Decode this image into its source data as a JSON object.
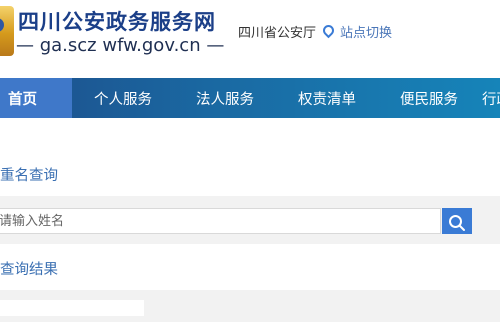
{
  "header": {
    "site_title": "四川公安政务服务网",
    "site_url": "— ga.scz wfw.gov.cn —",
    "department": "四川省公安厅",
    "switch_label": "站点切换"
  },
  "nav": {
    "items": [
      {
        "label": "首页",
        "active": true
      },
      {
        "label": "个人服务"
      },
      {
        "label": "法人服务"
      },
      {
        "label": "权责清单"
      },
      {
        "label": "便民服务"
      },
      {
        "label": "行政"
      }
    ]
  },
  "main": {
    "query_title": "重名查询",
    "search": {
      "placeholder": "请输入姓名",
      "value": ""
    },
    "result_title": "查询结果"
  },
  "icons": {
    "emblem": "police-emblem-icon",
    "location": "location-pin-icon",
    "search": "search-icon"
  },
  "colors": {
    "brand_blue": "#1b3f88",
    "accent_blue": "#3a7bd5",
    "link_blue": "#3a6fb2"
  }
}
